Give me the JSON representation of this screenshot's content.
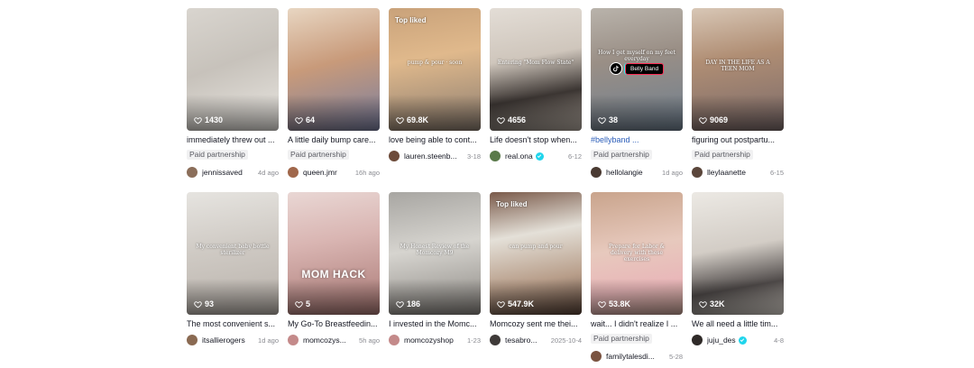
{
  "videos": [
    {
      "likes": "1430",
      "caption": "immediately threw out ...",
      "paid": "Paid partnership",
      "author": "jennissaved",
      "date": "4d ago",
      "verified": false,
      "top_liked": "",
      "overlay": "",
      "overlay_big": "",
      "bg": "linear-gradient(160deg,#d9d5cf 0%,#c7c2bb 45%,#e9e6e1 100%)",
      "avatar": "#8b6e5a"
    },
    {
      "likes": "64",
      "caption": "A little daily bump care...",
      "paid": "Paid partnership",
      "author": "queen.jmr",
      "date": "16h ago",
      "verified": false,
      "top_liked": "",
      "overlay": "",
      "overlay_big": "",
      "bg": "linear-gradient(165deg,#e8d6c2 0%,#c89a7a 45%,#7a7fa0 100%)",
      "avatar": "#a0674b"
    },
    {
      "likes": "69.8K",
      "caption": "love being able to cont...",
      "paid": "",
      "author": "lauren.steenb...",
      "date": "3-18",
      "verified": false,
      "top_liked": "Top liked",
      "overlay": "pump & pour  · soon",
      "overlay_big": "",
      "bg": "linear-gradient(170deg,#c9a27a 0%,#e0b98c 40%,#8a7c70 100%)",
      "avatar": "#6d4b3a"
    },
    {
      "likes": "4656",
      "caption": "Life doesn't stop when...",
      "paid": "",
      "author": "real.ona",
      "date": "6-12",
      "verified": true,
      "top_liked": "",
      "overlay": "Entering \"Mom Flow State\"",
      "overlay_big": "",
      "bg": "linear-gradient(170deg,#e3ddd6 0%,#cfc6bc 40%,#3b3532 70%,#b9afa5 100%)",
      "avatar": "#5a7a4a"
    },
    {
      "likes": "38",
      "caption": "#bellyband ...",
      "paid": "Paid partnership",
      "author": "hellolangie",
      "date": "1d ago",
      "verified": false,
      "top_liked": "",
      "overlay": "How I get myself on my feet everyday",
      "overlay_big": "",
      "tt_pill": "Belly Band",
      "bg": "linear-gradient(170deg,#b9b3ab 0%,#9a8f86 40%,#6f7f8f 100%)",
      "avatar": "#4a3a32"
    },
    {
      "likes": "9069",
      "caption": "figuring out postpartu...",
      "paid": "Paid partnership",
      "author": "lleylaanette",
      "date": "6-15",
      "verified": false,
      "top_liked": "",
      "overlay": "DAY IN THE LIFE AS A TEEN MOM",
      "overlay_big": "",
      "bg": "linear-gradient(170deg,#d8c7b6 0%,#b08e74 40%,#7a6a6a 100%)",
      "avatar": "#5b463b"
    },
    {
      "likes": "93",
      "caption": "The most convenient s...",
      "paid": "",
      "author": "itsallierogers",
      "date": "1d ago",
      "verified": false,
      "top_liked": "",
      "overlay": "My convenient baby bottle sterilizer",
      "overlay_big": "",
      "bg": "linear-gradient(170deg,#e6e4e0 0%,#cfcac4 45%,#b8b1aa 100%)",
      "avatar": "#8a6a52"
    },
    {
      "likes": "5",
      "caption": "My Go-To Breastfeedin...",
      "paid": "",
      "author": "momcozys...",
      "date": "5h ago",
      "verified": false,
      "top_liked": "",
      "overlay": "",
      "overlay_big": "MOM HACK",
      "bg": "linear-gradient(170deg,#e9d7d4 0%,#d9b5b2 40%,#a97874 100%)",
      "avatar": "#c48a8a"
    },
    {
      "likes": "186",
      "caption": "I invested in the Momc...",
      "paid": "",
      "author": "momcozyshop",
      "date": "1-23",
      "verified": false,
      "top_liked": "",
      "overlay": "My Honest Review of the Momcozy M9",
      "overlay_big": "",
      "bg": "linear-gradient(170deg,#a8a6a2 0%,#d6d4cf 45%,#8a8681 100%)",
      "avatar": "#c48a8a"
    },
    {
      "likes": "547.9K",
      "caption": "Momcozy sent me thei...",
      "paid": "",
      "author": "tesabro...",
      "date": "2025-10-4",
      "verified": false,
      "top_liked": "Top liked",
      "overlay": "can pump and pour",
      "overlay_big": "",
      "bg": "linear-gradient(170deg,#7a5a4a 0%,#e4e0d8 35%,#b89e8a 70%,#5a4438 100%)",
      "avatar": "#3e3a38"
    },
    {
      "likes": "53.8K",
      "caption": "wait... I didn't realize I ...",
      "paid": "Paid partnership",
      "author": "familytalesdi...",
      "date": "5-28",
      "verified": false,
      "top_liked": "",
      "overlay": "Prepare for Labor & delivery with these exercises",
      "overlay_big": "",
      "bg": "linear-gradient(170deg,#c9a48c 0%,#e7c9bd 45%,#e9b7b9 75%,#c6a196 100%)",
      "avatar": "#7a5340"
    },
    {
      "likes": "32K",
      "caption": "We all need a little tim...",
      "paid": "",
      "author": "juju_des",
      "date": "4-8",
      "verified": true,
      "top_liked": "",
      "overlay": "",
      "overlay_big": "",
      "bg": "linear-gradient(170deg,#ece9e4 0%,#d3cdc6 45%,#4f4a49 75%,#e4ded6 100%)",
      "avatar": "#2f2a28"
    }
  ]
}
